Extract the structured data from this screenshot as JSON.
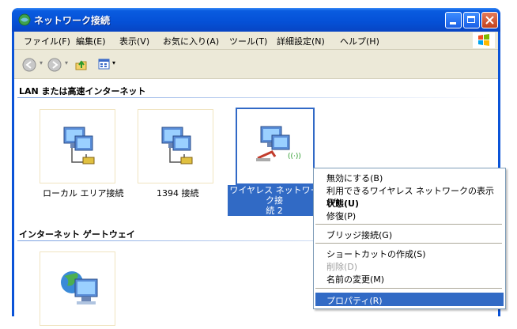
{
  "window": {
    "title": "ネットワーク接続"
  },
  "menubar": {
    "items": [
      "ファイル(F)",
      "編集(E)",
      "表示(V)",
      "お気に入り(A)",
      "ツール(T)",
      "詳細設定(N)",
      "ヘルプ(H)"
    ]
  },
  "groups": {
    "lan_header": "LAN または高速インターネット",
    "gateway_header": "インターネット ゲートウェイ"
  },
  "connections": [
    {
      "label": "ローカル エリア接続"
    },
    {
      "label": "1394 接続"
    },
    {
      "label_line1": "ワイヤレス ネットワーク接",
      "label_line2": "続 2"
    }
  ],
  "context_menu": {
    "items": [
      "無効にする(B)",
      "利用できるワイヤレス ネットワークの表示(V)",
      "状態(U)",
      "修復(P)",
      "ブリッジ接続(G)",
      "ショートカットの作成(S)",
      "削除(D)",
      "名前の変更(M)",
      "プロパティ(R)"
    ]
  },
  "colors": {
    "titlebar": "#0550d6",
    "selection": "#316ac5",
    "menubar_bg": "#ece9d8"
  },
  "icons": {
    "title": "network-connections-icon",
    "back": "back-arrow-icon",
    "forward": "forward-arrow-icon",
    "up": "up-folder-icon",
    "views": "views-icon"
  }
}
